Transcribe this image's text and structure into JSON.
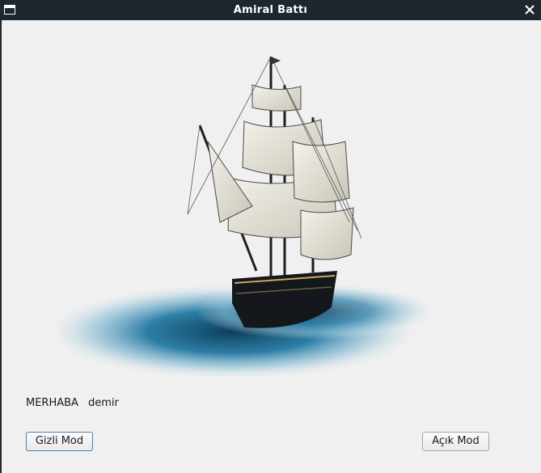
{
  "window": {
    "title": "Amiral Battı"
  },
  "icons": {
    "app": "window-icon",
    "close": "close-icon",
    "image": "sailing-ship-illustration"
  },
  "greeting": {
    "label": "MERHABA",
    "username": "demir"
  },
  "buttons": {
    "hidden_mode": "Gizli Mod",
    "open_mode": "Açık Mod"
  },
  "colors": {
    "titlebar": "#1f272e",
    "background": "#f0f0f0",
    "focus_border": "#4c7fb6"
  }
}
